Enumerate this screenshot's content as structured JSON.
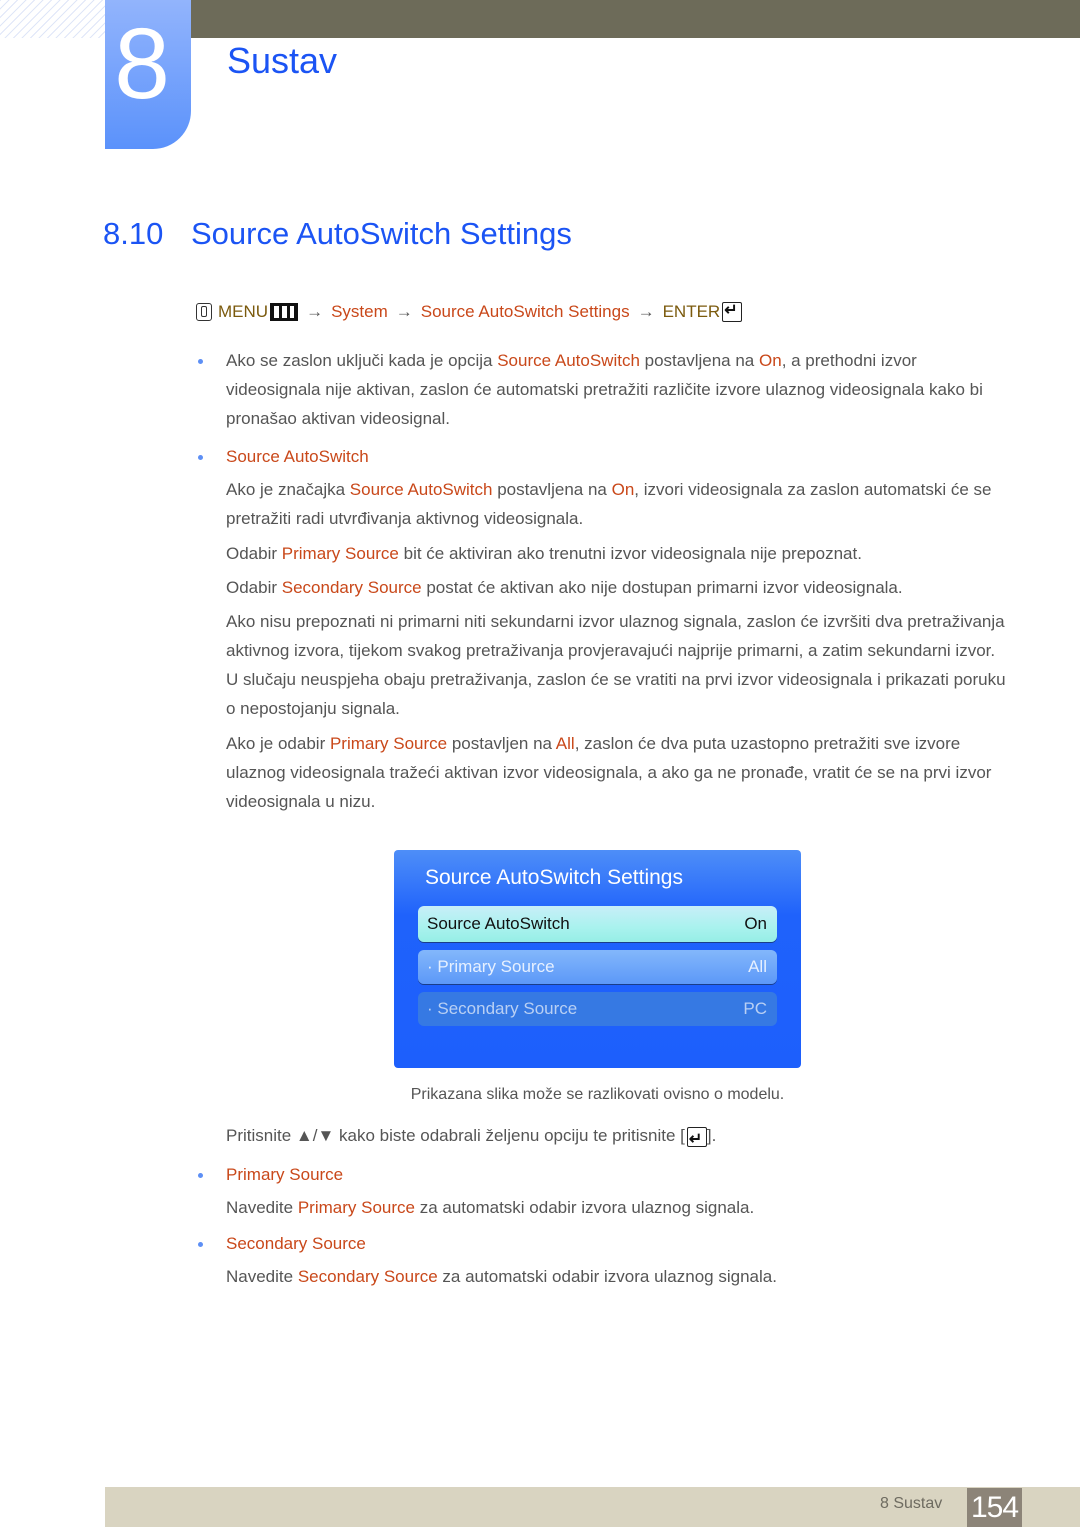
{
  "chapter": {
    "number": "8",
    "title": "Sustav"
  },
  "section": {
    "number": "8.10",
    "title": "Source AutoSwitch Settings"
  },
  "menu_path": {
    "menu": "MENU",
    "arrow": "→",
    "system": "System",
    "item": "Source AutoSwitch Settings",
    "enter": "ENTER"
  },
  "intro": {
    "p1": "Ako se zaslon uključi kada je opcija ",
    "h1": "Source AutoSwitch",
    "p2": " postavljena na ",
    "h2": "On",
    "p3": ", a prethodni izvor videosignala nije aktivan, zaslon će automatski pretražiti različite izvore ulaznog videosignala kako bi pronašao aktivan videosignal."
  },
  "source_autoswitch": {
    "heading": "Source AutoSwitch",
    "para1": {
      "a": "Ako je značajka ",
      "b": "Source AutoSwitch",
      "c": " postavljena na ",
      "d": "On",
      "e": ", izvori videosignala za zaslon automatski će se pretražiti radi utvrđivanja aktivnog videosignala."
    },
    "para2": {
      "a": "Odabir ",
      "b": "Primary Source",
      "c": " bit će aktiviran ako trenutni izvor videosignala nije prepoznat."
    },
    "para3": {
      "a": "Odabir ",
      "b": "Secondary Source",
      "c": " postat će aktivan ako nije dostupan primarni izvor videosignala."
    },
    "para4": "Ako nisu prepoznati ni primarni niti sekundarni izvor ulaznog signala, zaslon će izvršiti dva pretraživanja aktivnog izvora, tijekom svakog pretraživanja provjeravajući najprije primarni, a zatim sekundarni izvor. U slučaju neuspjeha obaju pretraživanja, zaslon će se vratiti na prvi izvor videosignala i prikazati poruku o nepostojanju signala.",
    "para5": {
      "a": "Ako je odabir ",
      "b": "Primary Source",
      "c": " postavljen na ",
      "d": "All",
      "e": ", zaslon će dva puta uzastopno pretražiti sve izvore ulaznog videosignala tražeći aktivan izvor videosignala, a ako ga ne pronađe, vratit će se na prvi izvor videosignala u nizu."
    }
  },
  "osd": {
    "title": "Source AutoSwitch Settings",
    "rows": [
      {
        "label": "Source AutoSwitch",
        "value": "On"
      },
      {
        "label": "· Primary Source",
        "value": "All"
      },
      {
        "label": "· Secondary Source",
        "value": "PC"
      }
    ]
  },
  "caption": "Prikazana slika može se razlikovati ovisno o modelu.",
  "instruction": {
    "a": "Pritisnite ▲/▼ kako biste odabrali željenu opciju te pritisnite [",
    "b": "]."
  },
  "primary_source": {
    "heading": "Primary Source",
    "para": {
      "a": "Navedite ",
      "b": "Primary Source",
      "c": " za automatski odabir izvora ulaznog signala."
    }
  },
  "secondary_source": {
    "heading": "Secondary Source",
    "para": {
      "a": "Navedite ",
      "b": "Secondary Source",
      "c": " za automatski odabir izvora ulaznog signala."
    }
  },
  "footer": {
    "label": "8 Sustav",
    "page": "154"
  }
}
